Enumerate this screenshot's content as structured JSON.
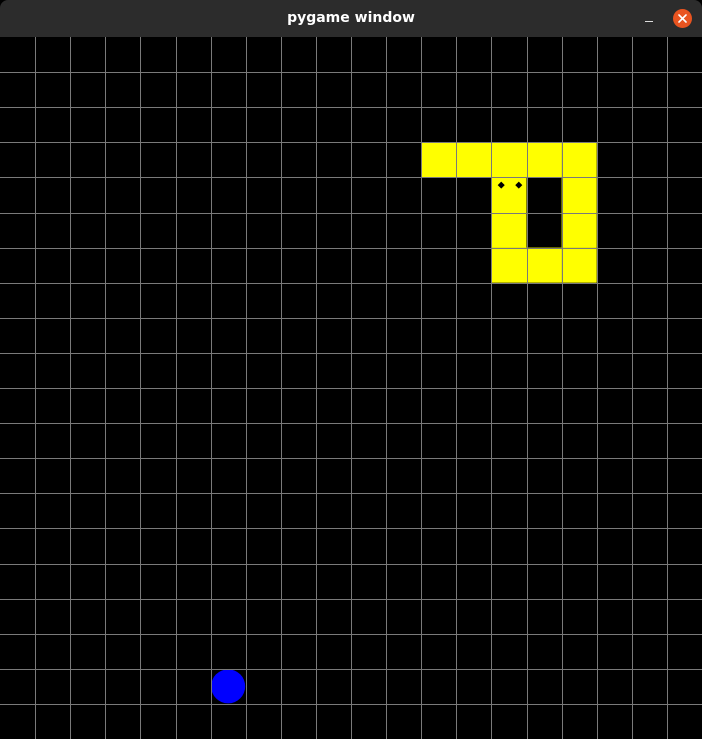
{
  "window": {
    "title": "pygame window",
    "minimize_icon": "minimize-icon",
    "close_icon": "close-icon"
  },
  "board": {
    "columns": 20,
    "rows": 20,
    "background_color": "#000000",
    "grid_color": "#7a7a7a"
  },
  "snake": {
    "color": "#ffff00",
    "eye_color": "#000000",
    "head": [
      14,
      4
    ],
    "segments": [
      [
        14,
        4
      ],
      [
        14,
        5
      ],
      [
        14,
        6
      ],
      [
        15,
        6
      ],
      [
        16,
        6
      ],
      [
        16,
        5
      ],
      [
        16,
        4
      ],
      [
        16,
        3
      ],
      [
        15,
        3
      ],
      [
        14,
        3
      ],
      [
        13,
        3
      ],
      [
        12,
        3
      ]
    ]
  },
  "food": {
    "color": "#0000ff",
    "cell": [
      6,
      18
    ]
  }
}
